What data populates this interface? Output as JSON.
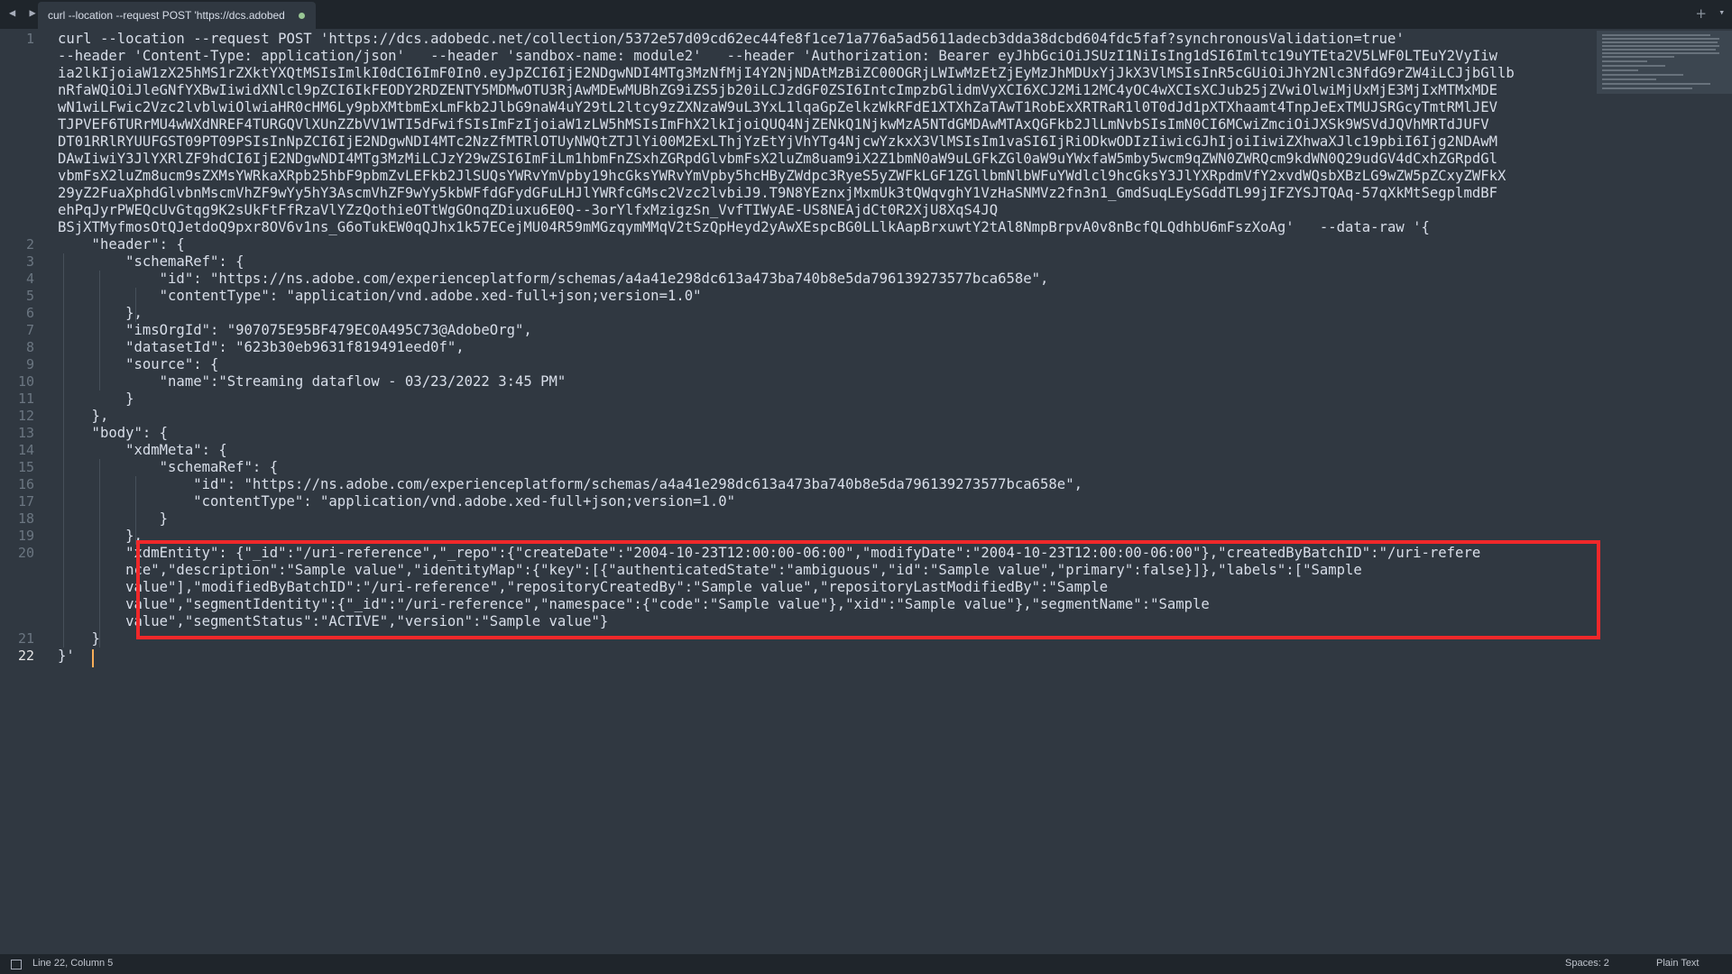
{
  "tab": {
    "title": "curl --location --request POST 'https://dcs.adobed",
    "add_symbol": "+",
    "menu_symbol": "▾"
  },
  "nav_arrows": "◀ ▶",
  "line_numbers": [
    "1",
    "2",
    "3",
    "4",
    "5",
    "6",
    "7",
    "8",
    "9",
    "10",
    "11",
    "12",
    "13",
    "14",
    "15",
    "16",
    "17",
    "18",
    "19",
    "20",
    "21",
    "22"
  ],
  "code_lines": [
    "curl --location --request POST 'https://dcs.adobedc.net/collection/5372e57d09cd62ec44fe8f1ce71a776a5ad5611adecb3dda38dcbd604fdc5faf?synchronousValidation=true'",
    "--header 'Content-Type: application/json'   --header 'sandbox-name: module2'   --header 'Authorization: Bearer eyJhbGciOiJSUzI1NiIsIng1dSI6Imltc19uYTEta2V5LWF0LTEuY2VyIiw",
    "ia2lkIjoiaW1zX25hMS1rZXktYXQtMSIsImlkI0dCI6ImF0In0.eyJpZCI6IjE2NDgwNDI4MTg3MzNfMjI4Y2NjNDAtMzBiZC00OGRjLWIwMzEtZjEyMzJhMDUxYjJkX3VlMSIsInR5cGUiOiJhY2Nlc3NfdG9rZW4iLCJjbGllb",
    "nRfaWQiOiJleGNfYXBwIiwidXNlcl9pZCI6IkFEODY2RDZENTY5MDMwOTU3RjAwMDEwMUBhZG9iZS5jb20iLCJzdGF0ZSI6IntcImpzbGlidmVyXCI6XCJ2Mi12MC4yOC4wXCIsXCJub25jZVwiOlwiMjUxMjE3MjIxMTMxMDE",
    "wN1wiLFwic2Vzc2lvblwiOlwiaHR0cHM6Ly9pbXMtbmExLmFkb2JlbG9naW4uY29tL2ltcy9zZXNzaW9uL3YxL1lqaGpZelkzWkRFdE1XTXhZaTAwT1RobExXRTRaR1l0T0dJd1pXTXhaamt4TnpJeExTMUJSRGcyTmtRMlJEV",
    "TJPVEF6TURrMU4wWXdNREF4TURGQVlXUnZZbVV1WTI5dFwifSIsImFzIjoiaW1zLW5hMSIsImFhX2lkIjoiQUQ4NjZENkQ1NjkwMzA5NTdGMDAwMTAxQGFkb2JlLmNvbSIsImN0CI6MCwiZmciOiJXSk9WSVdJQVhMRTdJUFV",
    "DT01RRlRYUUFGST09PT09PSIsInNpZCI6IjE2NDgwNDI4MTc2NzZfMTRlOTUyNWQtZTJlYi00M2ExLThjYzEtYjVhYTg4NjcwYzkxX3VlMSIsIm1vaSI6IjRiODkwODIzIiwicGJhIjoiIiwiZXhwaXJlc19pbiI6Ijg2NDAwM",
    "DAwIiwiY3JlYXRlZF9hdCI6IjE2NDgwNDI4MTg3MzMiLCJzY29wZSI6ImFiLm1hbmFnZSxhZGRpdGlvbmFsX2luZm8uam9iX2Z1bmN0aW9uLGFkZGl0aW9uYWxfaW5mby5wcm9qZWN0ZWRQcm9kdWN0Q29udGV4dCxhZGRpdGl",
    "vbmFsX2luZm8ucm9sZXMsYWRkaXRpb25hbF9pbmZvLEFkb2JlSUQsYWRvYmVpby19hcGksYWRvYmVpby5hcHByZWdpc3RyeS5yZWFkLGF1ZGllbmNlbWFuYWdlcl9hcGksY3JlYXRpdmVfY2xvdWQsbXBzLG9wZW5pZCxyZWFkX",
    "29yZ2FuaXphdGlvbnMscmVhZF9wYy5hY3AscmVhZF9wYy5kbWFfdGFydGFuLHJlYWRfcGMsc2Vzc2lvbiJ9.T9N8YEznxjMxmUk3tQWqvghY1VzHaSNMVz2fn3n1_GmdSuqLEySGddTL99jIFZYSJTQAq-57qXkMtSegplmdBF",
    "ehPqJyrPWEQcUvGtqg9K2sUkFtFfRzaVlYZzQothieOTtWgGOnqZDiuxu6E0Q--3orYlfxMzigzSn_VvfTIWyAE-US8NEAjdCt0R2XjU8XqS4JQ",
    "BSjXTMyfmosOtQJetdoQ9pxr8OV6v1ns_G6oTukEW0qQJhx1k57ECejMU04R59mMGzqymMMqV2tSzQpHeyd2yAwXEspcBG0LLlkAapBrxuwtY2tAl8NmpBrpvA0v8nBcfQLQdhbU6mFszXoAg'   --data-raw '{",
    "    \"header\": {",
    "        \"schemaRef\": {",
    "            \"id\": \"https://ns.adobe.com/experienceplatform/schemas/a4a41e298dc613a473ba740b8e5da796139273577bca658e\",",
    "            \"contentType\": \"application/vnd.adobe.xed-full+json;version=1.0\"",
    "        },",
    "        \"imsOrgId\": \"907075E95BF479EC0A495C73@AdobeOrg\",",
    "        \"datasetId\": \"623b30eb9631f819491eed0f\",",
    "        \"source\": {",
    "            \"name\":\"Streaming dataflow - 03/23/2022 3:45 PM\"",
    "        }",
    "    },",
    "    \"body\": {",
    "        \"xdmMeta\": {",
    "            \"schemaRef\": {",
    "                \"id\": \"https://ns.adobe.com/experienceplatform/schemas/a4a41e298dc613a473ba740b8e5da796139273577bca658e\",",
    "                \"contentType\": \"application/vnd.adobe.xed-full+json;version=1.0\"",
    "            }",
    "        },",
    "        \"xdmEntity\": {\"_id\":\"/uri-reference\",\"_repo\":{\"createDate\":\"2004-10-23T12:00:00-06:00\",\"modifyDate\":\"2004-10-23T12:00:00-06:00\"},\"createdByBatchID\":\"/uri-refere",
    "        nce\",\"description\":\"Sample value\",\"identityMap\":{\"key\":[{\"authenticatedState\":\"ambiguous\",\"id\":\"Sample value\",\"primary\":false}]},\"labels\":[\"Sample",
    "        value\"],\"modifiedByBatchID\":\"/uri-reference\",\"repositoryCreatedBy\":\"Sample value\",\"repositoryLastModifiedBy\":\"Sample",
    "        value\",\"segmentIdentity\":{\"_id\":\"/uri-reference\",\"namespace\":{\"code\":\"Sample value\"},\"xid\":\"Sample value\"},\"segmentName\":\"Sample",
    "        value\",\"segmentStatus\":\"ACTIVE\",\"version\":\"Sample value\"}",
    "    }",
    "}'"
  ],
  "status": {
    "position": "Line 22, Column 5",
    "spaces": "Spaces: 2",
    "syntax": "Plain Text"
  },
  "colors": {
    "editor_bg": "#303841",
    "highlight_box": "#f0282a",
    "cursor": "#f9ae58"
  }
}
